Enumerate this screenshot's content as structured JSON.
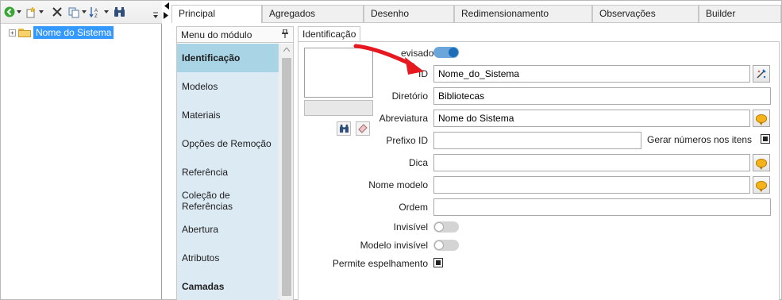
{
  "tree": {
    "root_label": "Nome do Sistema",
    "expander_symbol": "+"
  },
  "tabs": [
    {
      "label": "Principal",
      "active": true
    },
    {
      "label": "Agregados",
      "active": false
    },
    {
      "label": "Desenho",
      "active": false
    },
    {
      "label": "Redimensionamento",
      "active": false
    },
    {
      "label": "Observações",
      "active": false
    },
    {
      "label": "Builder",
      "active": false
    }
  ],
  "module_menu": {
    "title": "Menu do módulo",
    "items": [
      {
        "label": "Identificação",
        "selected": true
      },
      {
        "label": "Modelos",
        "selected": false
      },
      {
        "label": "Materiais",
        "selected": false
      },
      {
        "label": "Opções de Remoção",
        "selected": false
      },
      {
        "label": "Referência",
        "selected": false
      },
      {
        "label": "Coleção de Referências",
        "selected": false
      },
      {
        "label": "Abertura",
        "selected": false
      },
      {
        "label": "Atributos",
        "selected": false
      },
      {
        "label": "Camadas",
        "selected": false
      }
    ]
  },
  "details": {
    "tab_label": "Identificação",
    "revisado": {
      "label": "evisado",
      "on": true
    },
    "id": {
      "label": "ID",
      "value": "Nome_do_Sistema"
    },
    "diretorio": {
      "label": "Diretório",
      "value": "Bibliotecas"
    },
    "abreviatura": {
      "label": "Abreviatura",
      "value": "Nome do Sistema"
    },
    "prefixo_id": {
      "label": "Prefixo ID",
      "value": ""
    },
    "gerar_numeros": {
      "label": "Gerar números nos itens",
      "checked": true
    },
    "dica": {
      "label": "Dica",
      "value": ""
    },
    "nome_modelo": {
      "label": "Nome modelo",
      "value": ""
    },
    "ordem": {
      "label": "Ordem",
      "value": ""
    },
    "invisivel": {
      "label": "Invisível",
      "on": false
    },
    "modelo_invisivel": {
      "label": "Modelo invisível",
      "on": false
    },
    "permite_espelhamento": {
      "label": "Permite espelhamento",
      "checked": true
    }
  },
  "colors": {
    "accent_blue": "#3399ff",
    "menu_bg": "#dceaf4",
    "menu_selected": "#a8d4e6",
    "toggle_on": "#1e6db8",
    "annotation_arrow": "#e5191f"
  }
}
